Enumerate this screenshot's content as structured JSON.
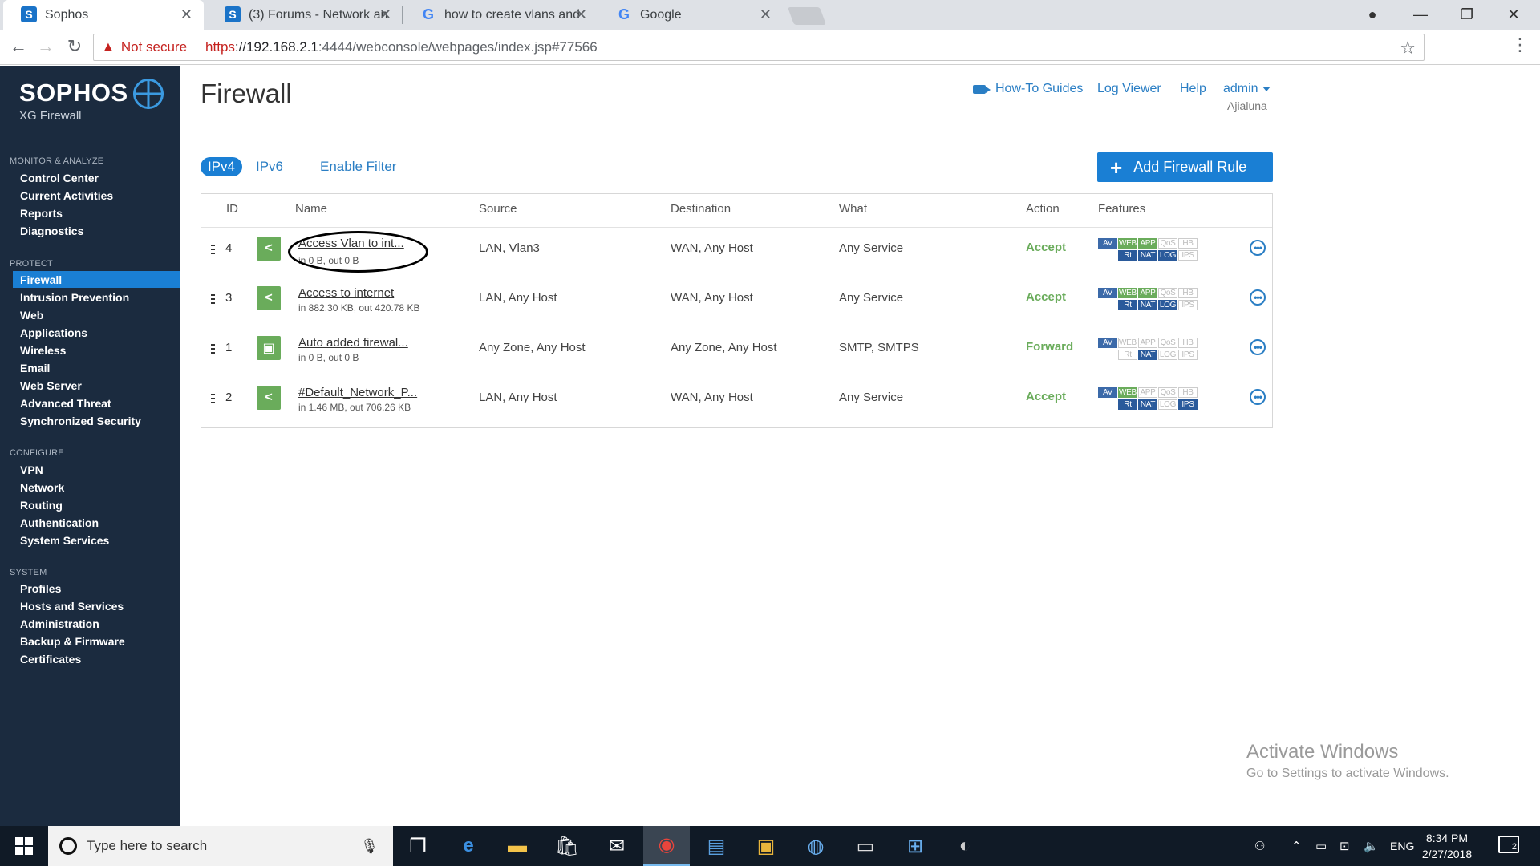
{
  "browser": {
    "tabs": [
      {
        "icon": "sophos-favicon",
        "title": "Sophos",
        "active": true
      },
      {
        "icon": "sophos-favicon",
        "title": "(3) Forums - Network an",
        "active": false
      },
      {
        "icon": "google-favicon",
        "title": "how to create vlans and",
        "active": false
      },
      {
        "icon": "google-favicon",
        "title": "Google",
        "active": false
      }
    ],
    "address": {
      "security_label": "Not secure",
      "scheme": "https",
      "host": "://192.168.2.1",
      "path": ":4444/webconsole/webpages/index.jsp#77566"
    }
  },
  "sidebar": {
    "brand": "SOPHOS",
    "product": "XG Firewall",
    "sections": [
      {
        "title": "MONITOR & ANALYZE",
        "items": [
          "Control Center",
          "Current Activities",
          "Reports",
          "Diagnostics"
        ]
      },
      {
        "title": "PROTECT",
        "items": [
          "Firewall",
          "Intrusion Prevention",
          "Web",
          "Applications",
          "Wireless",
          "Email",
          "Web Server",
          "Advanced Threat",
          "Synchronized Security"
        ]
      },
      {
        "title": "CONFIGURE",
        "items": [
          "VPN",
          "Network",
          "Routing",
          "Authentication",
          "System Services"
        ]
      },
      {
        "title": "SYSTEM",
        "items": [
          "Profiles",
          "Hosts and Services",
          "Administration",
          "Backup & Firmware",
          "Certificates"
        ]
      }
    ],
    "active_item": "Firewall"
  },
  "header": {
    "title": "Firewall",
    "links": {
      "howto": "How-To Guides",
      "logviewer": "Log Viewer",
      "help": "Help",
      "user": "admin"
    },
    "user_sub": "Ajialuna"
  },
  "filters": {
    "ipv4": "IPv4",
    "ipv6": "IPv6",
    "enable_filter": "Enable Filter",
    "add_button": "Add Firewall Rule"
  },
  "table": {
    "columns": [
      "ID",
      "Name",
      "Source",
      "Destination",
      "What",
      "Action",
      "Features"
    ],
    "rows": [
      {
        "id": "4",
        "icon": "share-icon",
        "name": "Access Vlan to int...",
        "traffic": "in 0 B, out 0 B",
        "source": "LAN, Vlan3",
        "destination": "WAN, Any Host",
        "what": "Any Service",
        "action": "Accept"
      },
      {
        "id": "3",
        "icon": "share-icon",
        "name": "Access to internet",
        "traffic": "in 882.30 KB, out 420.78 KB",
        "source": "LAN, Any Host",
        "destination": "WAN, Any Host",
        "what": "Any Service",
        "action": "Accept"
      },
      {
        "id": "1",
        "icon": "briefcase-icon",
        "name": "Auto added firewal...",
        "traffic": "in 0 B, out 0 B",
        "source": "Any Zone, Any Host",
        "destination": "Any Zone, Any Host",
        "what": "SMTP, SMTPS",
        "action": "Forward"
      },
      {
        "id": "2",
        "icon": "share-icon",
        "name": "#Default_Network_P...",
        "traffic": "in 1.46 MB, out 706.26 KB",
        "source": "LAN, Any Host",
        "destination": "WAN, Any Host",
        "what": "Any Service",
        "action": "Accept"
      }
    ],
    "feature_labels": {
      "av": "AV",
      "web": "WEB",
      "app": "APP",
      "qos": "QoS",
      "hb": "HB",
      "rt": "Rt",
      "nat": "NAT",
      "log": "LOG",
      "ips": "IPS"
    }
  },
  "watermark": {
    "line1": "Activate Windows",
    "line2": "Go to Settings to activate Windows."
  },
  "taskbar": {
    "search_placeholder": "Type here to search",
    "language": "ENG",
    "time": "8:34 PM",
    "date": "2/27/2018",
    "notification_count": "2"
  },
  "colors": {
    "sidebar_bg": "#1b2b3f",
    "accent": "#1a7fd4",
    "accept_green": "#6aac5b"
  }
}
